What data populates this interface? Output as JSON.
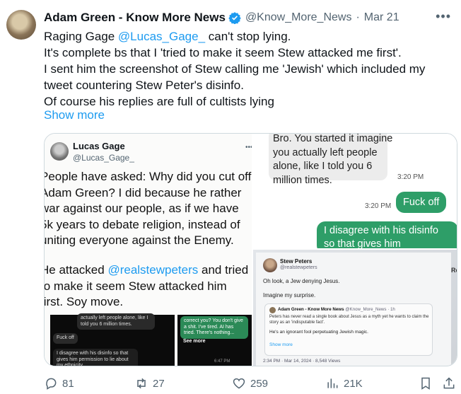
{
  "tweet": {
    "author_name": "Adam Green - Know More News",
    "author_handle": "@Know_More_News",
    "separator": "·",
    "date": "Mar 21",
    "text_line1_pre": "Raging Gage ",
    "text_line1_mention": "@Lucas_Gage_",
    "text_line1_post": " can't stop lying.",
    "text_line2": "It's complete bs that I 'tried to make it seem Stew attacked me first'.",
    "text_line3": "I sent him the screenshot of Stew calling me 'Jewish' which included my",
    "text_line4": "tweet countering Stew Peter's disinfo.",
    "text_line5": "Of course his replies are full of cultists lying",
    "show_more": "Show more"
  },
  "media": {
    "left": {
      "name": "Lucas Gage",
      "handle": "@Lucas_Gage_",
      "text1": "People have asked: Why did you cut off Adam Green? I did because he rather war against our people, as if we have 5k years to debate religion, instead of uniting everyone against the Enemy.",
      "text2_pre": "He attacked ",
      "text2_mention": "@realstewpeters",
      "text2_post": " and tried to make it seem Stew attacked him first. Soy move.",
      "dark1_bubble": "actually left people alone, like I told you 6 million times.",
      "dark1_fuckoff": "Fuck off",
      "dark1_green": "I disagree with his disinfo so that gives him permission to lie about my ethnicity",
      "dark2_green": "correct you? You don't give a shit. I've tired. AI has tried. There's nothing...",
      "dark2_seemore": "See more",
      "dark2_time": "6:47 PM"
    },
    "right_top": {
      "gray_bubble": "Bro. You started it imagine you actually left people alone, like I told you 6 million times.",
      "time1": "3:20 PM",
      "green1": "Fuck off",
      "time2": "3:20 PM",
      "green2": "I disagree with his disinfo so that gives him"
    },
    "right_bottom": {
      "name": "Stew Peters",
      "handle": "@realstewpeters",
      "text1": "Oh look, a Jew denying Jesus.",
      "text2": "Imagine my surprise.",
      "quote_name": "Adam Green - Know More News",
      "quote_meta": "@Know_More_News · 1h",
      "quote_text": "Peters has never read a single book about Jesus as a myth yet he wants to claim the story as an 'indisputable fact'.",
      "quote_text2": "He's an ignorant fool perpetuating Jewish magic.",
      "quote_more": "Show more",
      "footer": "2:34 PM · Mar 14, 2024 · 8,548 Views",
      "edge_label": "Re"
    }
  },
  "actions": {
    "replies": "81",
    "reposts": "27",
    "likes": "259",
    "views": "21K"
  },
  "colors": {
    "accent": "#1d9bf0",
    "chat_green": "#2e9e68",
    "muted": "#536471"
  }
}
